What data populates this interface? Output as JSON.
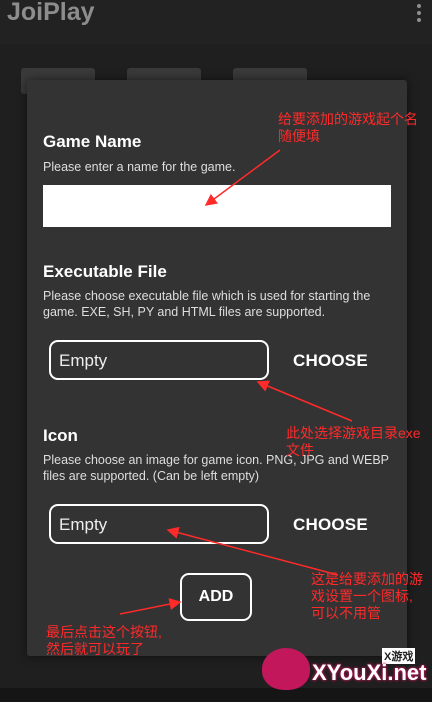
{
  "app": {
    "title": "JoiPlay"
  },
  "dialog": {
    "game_name": {
      "heading": "Game Name",
      "description": "Please enter a name for the game."
    },
    "executable": {
      "heading": "Executable File",
      "description": "Please choose executable file which is used for starting the game. EXE, SH, PY and HTML files are supported.",
      "field_value": "Empty",
      "choose_label": "CHOOSE"
    },
    "icon": {
      "heading": "Icon",
      "description": "Please choose an image for game icon. PNG, JPG and WEBP files are supported. (Can be left empty)",
      "field_value": "Empty",
      "choose_label": "CHOOSE"
    },
    "add_label": "ADD"
  },
  "annotations": {
    "name_note": "给要添加的游戏起个名\n随便填",
    "exe_note": "此处选择游戏目录exe\n文件",
    "icon_note": "这是给要添加的游\n戏设置一个图标,\n可以不用管",
    "add_note": "最后点击这个按钮,\n然后就可以玩了",
    "color": "#ff2a2a"
  },
  "watermark": {
    "text": "XYouXi.net",
    "top_text": "X游戏"
  }
}
